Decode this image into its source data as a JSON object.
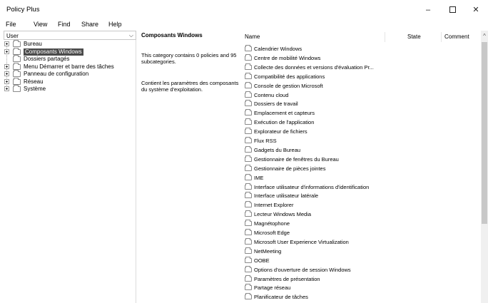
{
  "window": {
    "title": "Policy Plus",
    "minimize": "–",
    "close": "✕"
  },
  "menu": [
    "File",
    "View",
    "Find",
    "Share",
    "Help"
  ],
  "left": {
    "combo_value": "User",
    "tree": [
      {
        "label": "Bureau",
        "expander": true,
        "selected": false
      },
      {
        "label": "Composants Windows",
        "expander": true,
        "selected": true
      },
      {
        "label": "Dossiers partagés",
        "expander": false,
        "selected": false
      },
      {
        "label": "Menu Démarrer et barre des tâches",
        "expander": true,
        "selected": false
      },
      {
        "label": "Panneau de configuration",
        "expander": true,
        "selected": false
      },
      {
        "label": "Réseau",
        "expander": true,
        "selected": false
      },
      {
        "label": "Système",
        "expander": true,
        "selected": false
      }
    ]
  },
  "details": {
    "title": "Composants Windows",
    "summary": "This category contains 0 policies and 95 subcategories.",
    "description": "Contient les paramètres des composants du système d'exploitation."
  },
  "list": {
    "columns": {
      "name": "Name",
      "state": "State",
      "comment": "Comment"
    },
    "rows": [
      "Calendrier Windows",
      "Centre de mobilité Windows",
      "Collecte des données et versions d'évaluation Pr...",
      "Compatibilité des applications",
      "Console de gestion Microsoft",
      "Contenu cloud",
      "Dossiers de travail",
      "Emplacement et capteurs",
      "Exécution de l'application",
      "Explorateur de fichiers",
      "Flux RSS",
      "Gadgets du Bureau",
      "Gestionnaire de fenêtres du Bureau",
      "Gestionnaire de pièces jointes",
      "IME",
      "Interface utilisateur d'informations d'identification",
      "Interface utilisateur latérale",
      "Internet Explorer",
      "Lecteur Windows Media",
      "Magnétophone",
      "Microsoft Edge",
      "Microsoft User Experience Virtualization",
      "NetMeeting",
      "OOBE",
      "Options d'ouverture de session Windows",
      "Paramètres de présentation",
      "Partage réseau",
      "Planificateur de tâches"
    ]
  },
  "colors": {
    "selection": "#4a4a4a",
    "scroll_thumb": "#c8c8c8"
  },
  "icons": {
    "tree_item": "folder-icon",
    "list_item": "folder-icon",
    "expander": "plus-box-icon"
  }
}
